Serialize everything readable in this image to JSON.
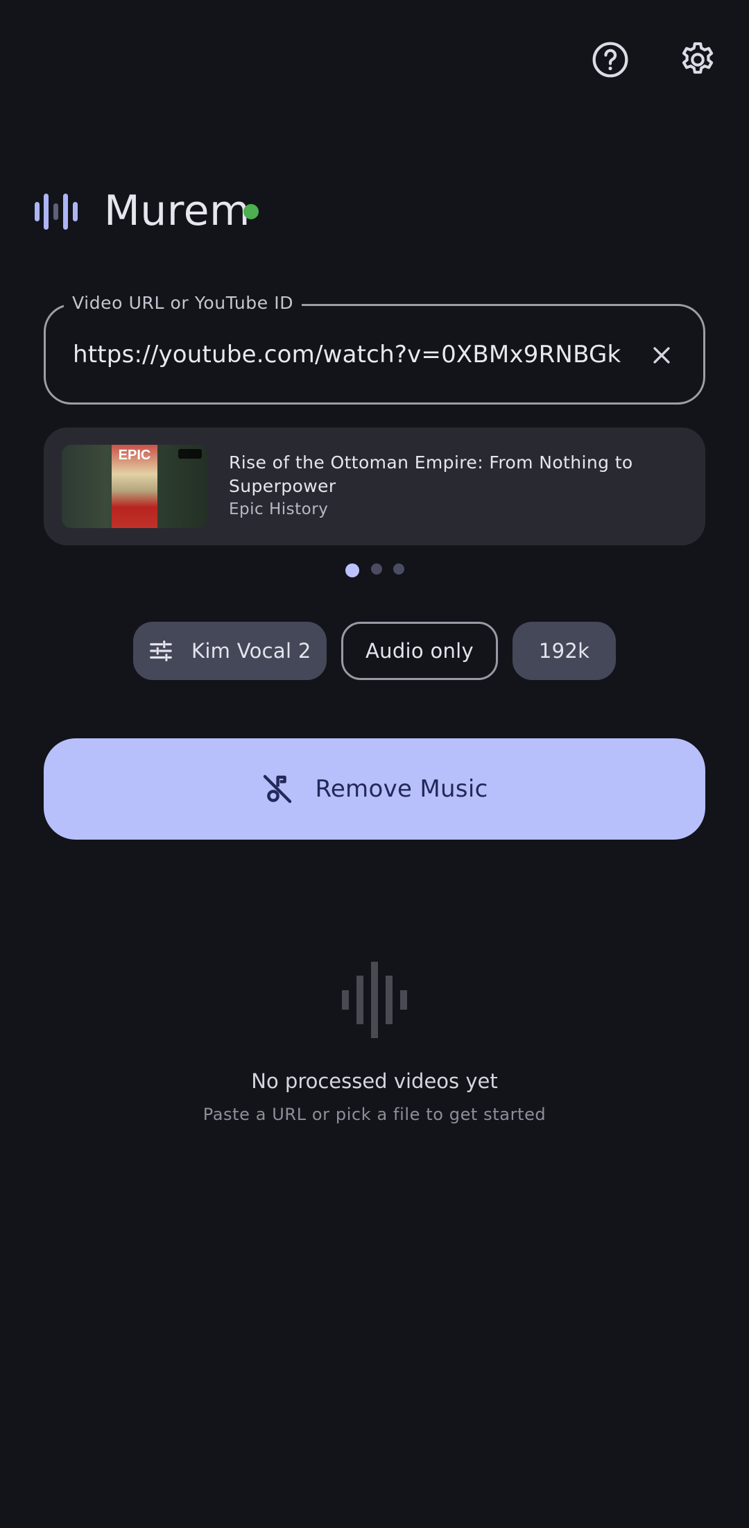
{
  "top_actions": {
    "help_icon": "help-circle-icon",
    "settings_icon": "gear-icon"
  },
  "header": {
    "title": "Murem",
    "status_color": "#4caf50"
  },
  "url_input": {
    "label": "Video URL or YouTube ID",
    "value": "https://youtube.com/watch?v=0XBMx9RNBGk"
  },
  "video": {
    "title": "Rise of the Ottoman Empire: From Nothing to Superpower",
    "channel": "Epic History",
    "thumbnail_text": "EPIC"
  },
  "pager": {
    "count": 3,
    "active_index": 0
  },
  "options": {
    "model": "Kim Vocal 2",
    "mode": "Audio only",
    "bitrate": "192k"
  },
  "primary_action": {
    "label": "Remove Music"
  },
  "empty_state": {
    "title": "No processed videos yet",
    "subtitle": "Paste a URL or pick a file to get started"
  },
  "colors": {
    "background": "#13141a",
    "accent": "#b8c0fb",
    "chip": "#454859"
  }
}
